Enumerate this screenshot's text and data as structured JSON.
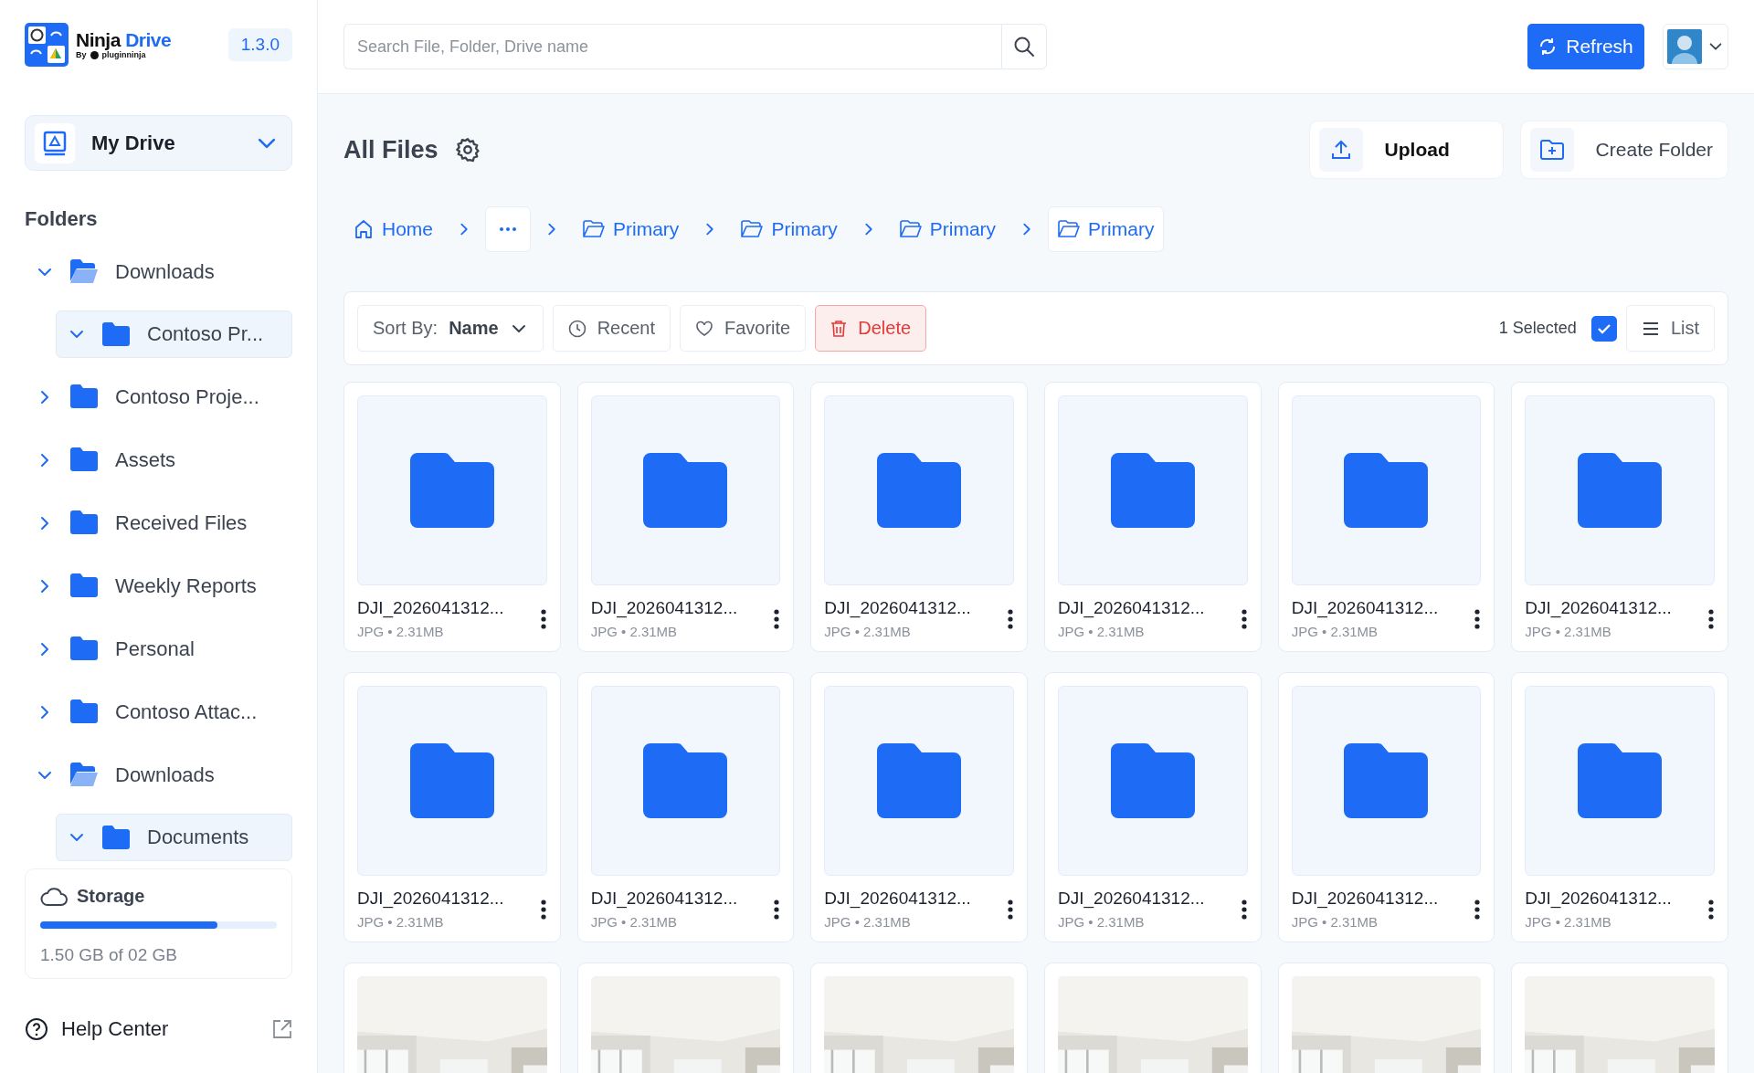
{
  "logo": {
    "name": "Ninja",
    "accent": "Drive",
    "byline": "By",
    "maker": "pluginninja"
  },
  "version": "1.3.0",
  "drive_selector": {
    "label": "My Drive"
  },
  "sidebar": {
    "heading": "Folders",
    "folders": [
      {
        "label": "Downloads",
        "expanded": true,
        "selected": false,
        "children": [
          {
            "label": "Contoso Pr...",
            "expanded": true,
            "selected": true
          }
        ]
      },
      {
        "label": "Contoso Proje...",
        "expanded": false,
        "selected": false
      },
      {
        "label": "Assets",
        "expanded": false,
        "selected": false
      },
      {
        "label": "Received Files",
        "expanded": false,
        "selected": false
      },
      {
        "label": "Weekly Reports",
        "expanded": false,
        "selected": false
      },
      {
        "label": "Personal",
        "expanded": false,
        "selected": false
      },
      {
        "label": "Contoso Attac...",
        "expanded": false,
        "selected": false
      },
      {
        "label": "Downloads",
        "expanded": true,
        "selected": false,
        "children": [
          {
            "label": "Documents",
            "expanded": true,
            "selected": true
          }
        ]
      }
    ]
  },
  "storage": {
    "title": "Storage",
    "level": 0.75,
    "usage": "1.50 GB of 02 GB"
  },
  "help": {
    "label": "Help Center"
  },
  "search": {
    "placeholder": "Search File, Folder, Drive name"
  },
  "refresh_button": {
    "label": "Refresh"
  },
  "page": {
    "title": "All Files"
  },
  "actions": [
    {
      "kind": "upload",
      "label": "Upload"
    },
    {
      "kind": "create_folder",
      "label": "Create Folder"
    }
  ],
  "breadcrumb": [
    {
      "kind": "home",
      "label": "Home",
      "selected": false
    },
    {
      "kind": "more",
      "selected": true
    },
    {
      "kind": "folder",
      "label": "Primary",
      "selected": false
    },
    {
      "kind": "folder",
      "label": "Primary",
      "selected": false
    },
    {
      "kind": "folder",
      "label": "Primary",
      "selected": false
    },
    {
      "kind": "folder",
      "label": "Primary",
      "selected": true
    }
  ],
  "toolbar": {
    "sort": {
      "label": "Sort By:",
      "value": "Name"
    },
    "filters": [
      {
        "kind": "recent",
        "label": "Recent"
      },
      {
        "kind": "favorite",
        "label": "Favorite"
      },
      {
        "kind": "delete",
        "label": "Delete"
      }
    ],
    "selection": {
      "count": "1 Selected",
      "checked": true
    },
    "view": {
      "label": "List"
    }
  },
  "files": [
    {
      "kind": "folder",
      "name": "DJI_2026041312...",
      "meta": "JPG • 2.31MB"
    },
    {
      "kind": "folder",
      "name": "DJI_2026041312...",
      "meta": "JPG • 2.31MB"
    },
    {
      "kind": "folder",
      "name": "DJI_2026041312...",
      "meta": "JPG • 2.31MB"
    },
    {
      "kind": "folder",
      "name": "DJI_2026041312...",
      "meta": "JPG • 2.31MB"
    },
    {
      "kind": "folder",
      "name": "DJI_2026041312...",
      "meta": "JPG • 2.31MB"
    },
    {
      "kind": "folder",
      "name": "DJI_2026041312...",
      "meta": "JPG • 2.31MB"
    },
    {
      "kind": "folder",
      "name": "DJI_2026041312...",
      "meta": "JPG • 2.31MB"
    },
    {
      "kind": "folder",
      "name": "DJI_2026041312...",
      "meta": "JPG • 2.31MB"
    },
    {
      "kind": "folder",
      "name": "DJI_2026041312...",
      "meta": "JPG • 2.31MB"
    },
    {
      "kind": "folder",
      "name": "DJI_2026041312...",
      "meta": "JPG • 2.31MB"
    },
    {
      "kind": "folder",
      "name": "DJI_2026041312...",
      "meta": "JPG • 2.31MB"
    },
    {
      "kind": "folder",
      "name": "DJI_2026041312...",
      "meta": "JPG • 2.31MB"
    },
    {
      "kind": "picture"
    },
    {
      "kind": "picture"
    },
    {
      "kind": "picture"
    },
    {
      "kind": "picture"
    },
    {
      "kind": "picture"
    },
    {
      "kind": "picture"
    }
  ]
}
